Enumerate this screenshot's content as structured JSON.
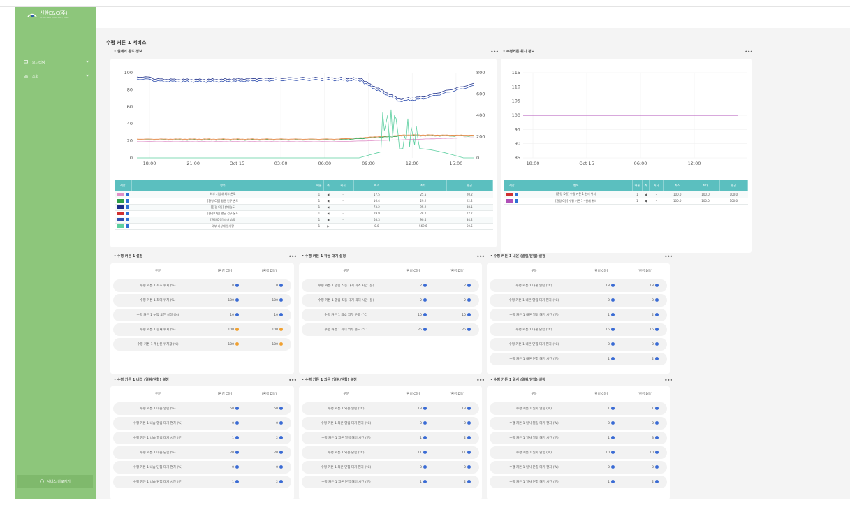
{
  "brand": {
    "name": "신한E&C(주)",
    "sub": "SHINHAN E&C CO., LTD."
  },
  "nav": [
    {
      "label": "모니터링"
    },
    {
      "label": "조회"
    }
  ],
  "footer_label": "서비스 바로가기",
  "page_title": "수평 커튼 1 서비스",
  "chart1": {
    "title": "실내외 온도 정보",
    "chart_data": {
      "type": "line",
      "x_ticks": [
        "18:00",
        "21:00",
        "Oct 15",
        "03:00",
        "06:00",
        "09:00",
        "12:00",
        "15:00"
      ],
      "y_left_ticks": [
        "0",
        "20",
        "40",
        "60",
        "80",
        "100"
      ],
      "y_right_ticks": [
        "0",
        "200",
        "400",
        "600",
        "800"
      ],
      "ylim_left": [
        0,
        100
      ],
      "ylim_right": [
        0,
        800
      ]
    },
    "columns": [
      "색상",
      "항목",
      "배율",
      "축",
      "커서",
      "최소",
      "최대",
      "평균"
    ],
    "rows": [
      {
        "color": "#e090c8",
        "name": "외부 기상대 외부 온도",
        "scale": "1",
        "axis": "◀",
        "cursor": "-",
        "min": "17.5",
        "max": "25.5",
        "avg": "20.2"
      },
      {
        "color": "#2e9e4a",
        "name": "[환경 C동] 평균 건구 온도",
        "scale": "1",
        "axis": "◀",
        "cursor": "-",
        "min": "16.4",
        "max": "29.2",
        "avg": "22.2"
      },
      {
        "color": "#1c2e8a",
        "name": "[환경 C동] 상대습도",
        "scale": "1",
        "axis": "◀",
        "cursor": "-",
        "min": "73.2",
        "max": "95.2",
        "avg": "88.1"
      },
      {
        "color": "#d03030",
        "name": "[환경 D동] 평균 건구 온도",
        "scale": "1",
        "axis": "◀",
        "cursor": "-",
        "min": "19.9",
        "max": "28.2",
        "avg": "22.7"
      },
      {
        "color": "#3050b0",
        "name": "[환경 D동] 상대 습도",
        "scale": "1",
        "axis": "◀",
        "cursor": "-",
        "min": "68.3",
        "max": "90.4",
        "avg": "84.2"
      },
      {
        "color": "#5ccfa0",
        "name": "외부 기상대 일사량",
        "scale": "1",
        "axis": "▶",
        "cursor": "-",
        "min": "0.0",
        "max": "569.6",
        "avg": "60.5"
      }
    ]
  },
  "chart2": {
    "title": "수평커튼 위치 정보",
    "chart_data": {
      "type": "line",
      "x_ticks": [
        "18:00",
        "Oct 15",
        "06:00",
        "12:00"
      ],
      "y_ticks": [
        "85",
        "90",
        "95",
        "100",
        "105",
        "110",
        "115"
      ],
      "ylim": [
        85,
        115
      ]
    },
    "columns": [
      "색상",
      "항목",
      "배율",
      "축",
      "커서",
      "최소",
      "최대",
      "평균"
    ],
    "rows": [
      {
        "color": "#d03030",
        "name": "[환경 D동] 수평 커튼 1 현재 위치",
        "scale": "1",
        "axis": "◀",
        "cursor": "-",
        "min": "100.0",
        "max": "100.0",
        "avg": "100.0"
      },
      {
        "color": "#b050b8",
        "name": "[환경 C동] 수평 커튼 1 - 현재 위치",
        "scale": "1",
        "axis": "◀",
        "cursor": "-",
        "min": "100.0",
        "max": "100.0",
        "avg": "100.0"
      }
    ]
  },
  "cards": [
    {
      "title": "수평 커튼 1 설정",
      "cols": [
        "구분",
        "[환경 C동]",
        "[환경 D동]"
      ],
      "rows": [
        {
          "label": "수평 커튼 1 최소 위치 (%)",
          "c": "0",
          "d": "0",
          "co": false,
          "do": false
        },
        {
          "label": "수평 커튼 1 최대 위치 (%)",
          "c": "100",
          "d": "100",
          "co": false,
          "do": false
        },
        {
          "label": "수평 커튼 1 누적 오픈 설정 (%)",
          "c": "10",
          "d": "10",
          "co": false,
          "do": false
        },
        {
          "label": "수평 커튼 1 현재 위치 (%)",
          "c": "100",
          "d": "100",
          "co": true,
          "do": true
        },
        {
          "label": "수평 커튼 1 계산된 위치값 (%)",
          "c": "100",
          "d": "100",
          "co": true,
          "do": true
        }
      ]
    },
    {
      "title": "수평 커튼 1 작동 대기 설정",
      "cols": [
        "구분",
        "[환경 C동]",
        "[환경 D동]"
      ],
      "rows": [
        {
          "label": "수평 커튼 1 열림 작동 대기 최소 시간 (분)",
          "c": "2",
          "d": "2",
          "co": false,
          "do": false
        },
        {
          "label": "수평 커튼 1 열림 작동 대기 최대 시간 (분)",
          "c": "2",
          "d": "2",
          "co": false,
          "do": false
        },
        {
          "label": "수평 커튼 1 최소 외부 온도 (°C)",
          "c": "10",
          "d": "10",
          "co": false,
          "do": false
        },
        {
          "label": "수평 커튼 1 최대 외부 온도 (°C)",
          "c": "25",
          "d": "25",
          "co": false,
          "do": false
        }
      ]
    },
    {
      "title": "수평 커튼 1 내온 (열림/닫힘) 설정",
      "cols": [
        "구분",
        "[환경 C동]",
        "[환경 D동]"
      ],
      "rows": [
        {
          "label": "수평 커튼 1 내온 열림 (°C)",
          "c": "18",
          "d": "18",
          "co": false,
          "do": false
        },
        {
          "label": "수평 커튼 1 내온 열림 대기 편차 (°C)",
          "c": "0",
          "d": "0",
          "co": false,
          "do": false
        },
        {
          "label": "수평 커튼 1 내온 열림 대기 시간 (분)",
          "c": "1",
          "d": "2",
          "co": false,
          "do": false
        },
        {
          "label": "수평 커튼 1 내온 닫힘 (°C)",
          "c": "15",
          "d": "15",
          "co": false,
          "do": false
        },
        {
          "label": "수평 커튼 1 내온 닫힘 대기 편차 (°C)",
          "c": "0",
          "d": "0",
          "co": false,
          "do": false
        },
        {
          "label": "수평 커튼 1 내온 닫힘 대기 시간 (분)",
          "c": "1",
          "d": "2",
          "co": false,
          "do": false
        }
      ]
    },
    {
      "title": "수평 커튼 1 내습 (열림/닫힘) 설정",
      "cols": [
        "구분",
        "[환경 C동]",
        "[환경 D동]"
      ],
      "rows": [
        {
          "label": "수평 커튼 1 내습 열림 (%)",
          "c": "50",
          "d": "50",
          "co": false,
          "do": false
        },
        {
          "label": "수평 커튼 1 내습 열림 대기 편차 (%)",
          "c": "0",
          "d": "0",
          "co": false,
          "do": false
        },
        {
          "label": "수평 커튼 1 내습 열림 대기 시간 (분)",
          "c": "1",
          "d": "2",
          "co": false,
          "do": false
        },
        {
          "label": "수평 커튼 1 내습 닫힘 (%)",
          "c": "20",
          "d": "20",
          "co": false,
          "do": false
        },
        {
          "label": "수평 커튼 1 내습 닫힘 대기 편차 (%)",
          "c": "0",
          "d": "0",
          "co": false,
          "do": false
        },
        {
          "label": "수평 커튼 1 내습 닫힘 대기 시간 (분)",
          "c": "1",
          "d": "2",
          "co": false,
          "do": false
        }
      ]
    },
    {
      "title": "수평 커튼 1 외온 (열림/닫힘) 설정",
      "cols": [
        "구분",
        "[환경 C동]",
        "[환경 D동]"
      ],
      "rows": [
        {
          "label": "수평 커튼 1 외온 열림 (°C)",
          "c": "13",
          "d": "13",
          "co": false,
          "do": false
        },
        {
          "label": "수평 커튼 1 외온 열림 대기 편차 (°C)",
          "c": "0",
          "d": "0",
          "co": false,
          "do": false
        },
        {
          "label": "수평 커튼 1 외온 열림 대기 시간 (분)",
          "c": "1",
          "d": "2",
          "co": false,
          "do": false
        },
        {
          "label": "수평 커튼 1 외온 닫힘 (°C)",
          "c": "11",
          "d": "11",
          "co": false,
          "do": false
        },
        {
          "label": "수평 커튼 1 외온 닫힘 대기 편차 (°C)",
          "c": "0",
          "d": "0",
          "co": false,
          "do": false
        },
        {
          "label": "수평 커튼 1 외온 닫힘 대기 시간 (분)",
          "c": "1",
          "d": "2",
          "co": false,
          "do": false
        }
      ]
    },
    {
      "title": "수평 커튼 1 일사 (열림/닫힘) 설정",
      "cols": [
        "구분",
        "[환경 C동]",
        "[환경 D동]"
      ],
      "rows": [
        {
          "label": "수평 커튼 1 일사 열림 (W)",
          "c": "1",
          "d": "1",
          "co": false,
          "do": false
        },
        {
          "label": "수평 커튼 1 일사 열림 대기 편차 (W)",
          "c": "0",
          "d": "0",
          "co": false,
          "do": false
        },
        {
          "label": "수평 커튼 1 일사 열림 대기 시간 (분)",
          "c": "1",
          "d": "3",
          "co": false,
          "do": false
        },
        {
          "label": "수평 커튼 1 일사 닫힘 (W)",
          "c": "10",
          "d": "10",
          "co": false,
          "do": false
        },
        {
          "label": "수평 커튼 1 일사 닫힘 대기 편차 (W)",
          "c": "0",
          "d": "0",
          "co": false,
          "do": false
        },
        {
          "label": "수평 커튼 1 일사 닫힘 대기 시간 (분)",
          "c": "1",
          "d": "2",
          "co": false,
          "do": false
        }
      ]
    }
  ]
}
